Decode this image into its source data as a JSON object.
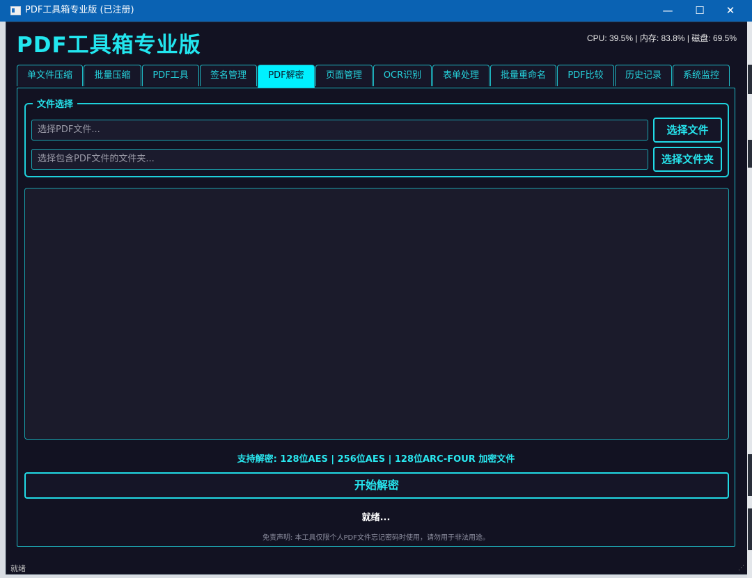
{
  "window": {
    "title": "PDF工具箱专业版 (已注册)",
    "controls": {
      "minimize": "—",
      "maximize": "☐",
      "close": "✕"
    }
  },
  "app": {
    "title": "PDF工具箱专业版",
    "system_stats": "CPU: 39.5% | 内存: 83.8% | 磁盘: 69.5%"
  },
  "tabs": [
    {
      "label": "单文件压缩"
    },
    {
      "label": "批量压缩"
    },
    {
      "label": "PDF工具"
    },
    {
      "label": "签名管理"
    },
    {
      "label": "PDF解密",
      "active": true
    },
    {
      "label": "页面管理"
    },
    {
      "label": "OCR识别"
    },
    {
      "label": "表单处理"
    },
    {
      "label": "批量重命名"
    },
    {
      "label": "PDF比较"
    },
    {
      "label": "历史记录"
    },
    {
      "label": "系统监控"
    }
  ],
  "file_select": {
    "group_title": "文件选择",
    "file_input_placeholder": "选择PDF文件...",
    "folder_input_placeholder": "选择包含PDF文件的文件夹...",
    "choose_file_button": "选择文件",
    "choose_folder_button": "选择文件夹"
  },
  "support_text": "支持解密: 128位AES | 256位AES | 128位ARC-FOUR 加密文件",
  "start_button": "开始解密",
  "status_text": "就绪...",
  "disclaimer": "免责声明: 本工具仅限个人PDF文件忘记密码时使用，请勿用于非法用途。",
  "statusbar_text": "就绪",
  "colors": {
    "titlebar": "#0a62b3",
    "background": "#121222",
    "accent": "#00f0ff",
    "text_accent": "#26e5ee"
  }
}
